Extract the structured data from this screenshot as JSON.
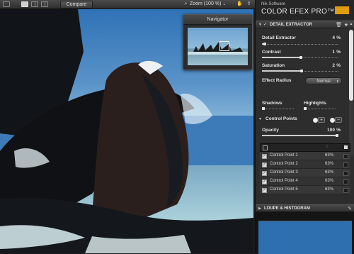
{
  "toolbar": {
    "compare_label": "Compare",
    "zoom_label": "Zoom (100 %)",
    "zoom_chevron": "⌄",
    "view_modes": [
      "single-view-icon",
      "split-view-icon",
      "side-by-side-view-icon"
    ],
    "tools": [
      "zoom-icon",
      "hand-icon",
      "export-icon"
    ]
  },
  "navigator": {
    "title": "Navigator"
  },
  "brand": {
    "company": "Nik Software",
    "product": "COLOR EFEX PRO™",
    "version": "4",
    "logo_color": "#e09b0e"
  },
  "detail_extractor": {
    "header": "DETAIL EXTRACTOR",
    "checkmark": "✓",
    "sliders": [
      {
        "label": "Detail Extractor",
        "value": "4",
        "unit": "%",
        "level": 4
      },
      {
        "label": "Contrast",
        "value": "1",
        "unit": "%",
        "level": 51
      },
      {
        "label": "Saturation",
        "value": "2",
        "unit": "%",
        "level": 52
      }
    ],
    "effect_radius_label": "Effect Radius",
    "effect_radius_value": "Normal",
    "shadows_label": "Shadows",
    "highlights_label": "Highlights",
    "control_points_label": "Control Points",
    "opacity_label": "Opacity",
    "opacity_value": "100",
    "opacity_unit": "%",
    "opacity_level": 100
  },
  "control_points": [
    {
      "name": "Control Point 1",
      "pct": "63%",
      "checked": true
    },
    {
      "name": "Control Point 2",
      "pct": "63%",
      "checked": true
    },
    {
      "name": "Control Point 3",
      "pct": "63%",
      "checked": true
    },
    {
      "name": "Control Point 4",
      "pct": "63%",
      "checked": true
    },
    {
      "name": "Control Point 5",
      "pct": "63%",
      "checked": true
    }
  ],
  "loupe": {
    "header": "LOUPE & HISTOGRAM"
  },
  "colors": {
    "accent": "#f0a30a",
    "panel_bg": "#2d2d2d",
    "sky": "#3d7ab8"
  }
}
